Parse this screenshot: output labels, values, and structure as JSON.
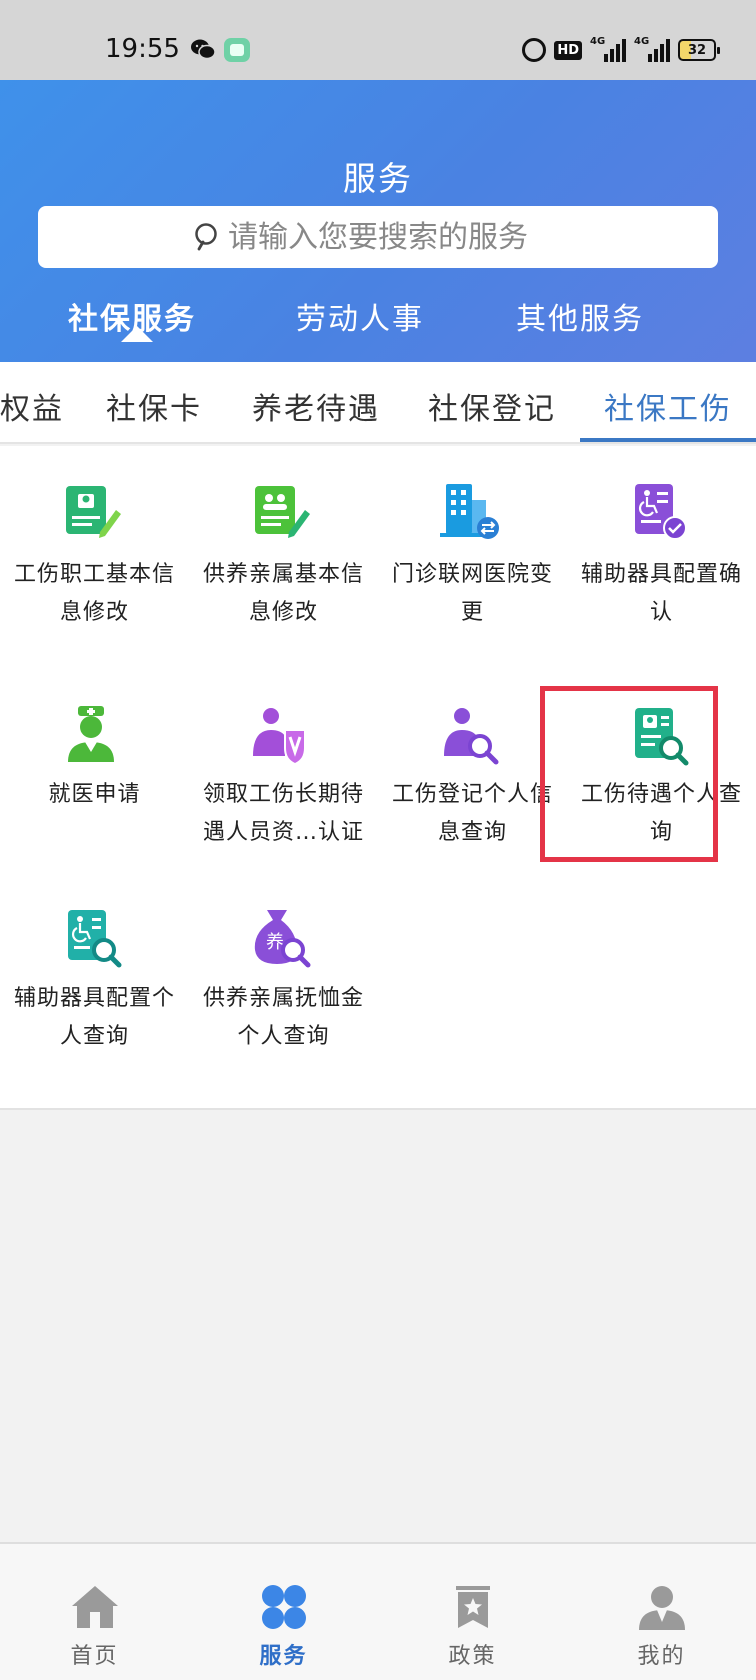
{
  "status_bar": {
    "time": "19:55",
    "hd_label": "HD",
    "signal1_label": "4G",
    "signal2_label": "4G",
    "battery": "32"
  },
  "header": {
    "title": "服务",
    "search_placeholder": "请输入您要搜索的服务",
    "tabs": [
      {
        "label": "社保服务",
        "active": true
      },
      {
        "label": "劳动人事",
        "active": false
      },
      {
        "label": "其他服务",
        "active": false
      }
    ]
  },
  "category_tabs": [
    {
      "label": "权益",
      "active": false
    },
    {
      "label": "社保卡",
      "active": false
    },
    {
      "label": "养老待遇",
      "active": false
    },
    {
      "label": "社保登记",
      "active": false
    },
    {
      "label": "社保工伤",
      "active": true
    }
  ],
  "services": [
    {
      "label": "工伤职工基本信息修改",
      "icon": "worker-info-edit-icon"
    },
    {
      "label": "供养亲属基本信息修改",
      "icon": "dependent-info-edit-icon"
    },
    {
      "label": "门诊联网医院变更",
      "icon": "hospital-change-icon"
    },
    {
      "label": "辅助器具配置确认",
      "icon": "assistive-device-confirm-icon"
    },
    {
      "label": "就医申请",
      "icon": "nurse-icon"
    },
    {
      "label": "领取工伤长期待遇人员资…认证",
      "icon": "long-term-benefit-verify-icon"
    },
    {
      "label": "工伤登记个人信息查询",
      "icon": "registration-query-icon"
    },
    {
      "label": "工伤待遇个人查询",
      "icon": "benefit-query-icon"
    },
    {
      "label": "辅助器具配置个人查询",
      "icon": "assistive-device-query-icon"
    },
    {
      "label": "供养亲属抚恤金个人查询",
      "icon": "pension-query-icon"
    }
  ],
  "pension_badge": "养",
  "bottom_nav": [
    {
      "label": "首页",
      "icon": "home-icon",
      "active": false
    },
    {
      "label": "服务",
      "icon": "service-grid-icon",
      "active": true
    },
    {
      "label": "政策",
      "icon": "policy-bookmark-icon",
      "active": false
    },
    {
      "label": "我的",
      "icon": "profile-icon",
      "active": false
    }
  ],
  "colors": {
    "header_start": "#3f91ea",
    "header_end": "#5d7fe1",
    "accent": "#3b78c4",
    "highlight": "#e43447",
    "green": "#2bb573",
    "purple": "#9353d9"
  }
}
